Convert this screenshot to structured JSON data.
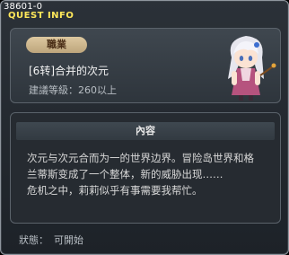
{
  "window": {
    "quest_id": "38601-0",
    "title": "QUEST INFO"
  },
  "info": {
    "job_badge": "職業",
    "job_name": "[6转]合并的次元",
    "level_requirement": "建議等級：260以上"
  },
  "content": {
    "header": "內容",
    "lines": [
      "次元与次元合而为一的世界边界。冒险岛世界和格",
      "兰蒂斯变成了一个整体，新的威胁出现……",
      "危机之中，莉莉似乎有事需要我帮忙。"
    ]
  },
  "status": {
    "label": "狀態：",
    "value": "可開始"
  },
  "colors": {
    "title": "#ffe85a",
    "badge": "#ddc8a0",
    "panel": "#2e353c"
  }
}
